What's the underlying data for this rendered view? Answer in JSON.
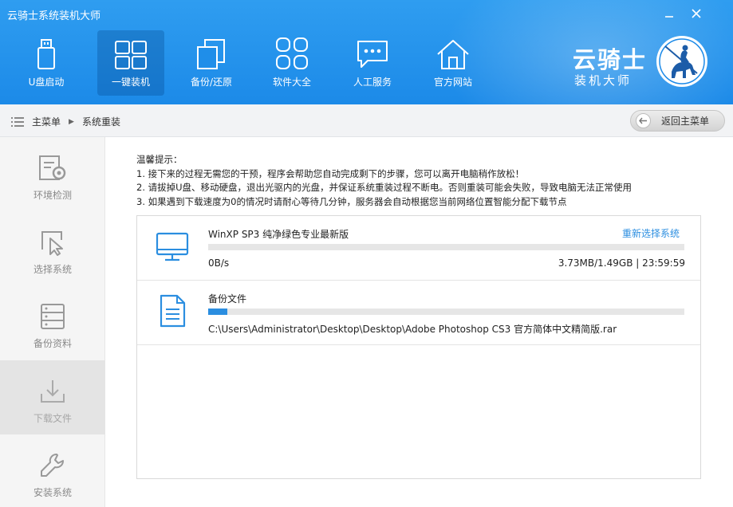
{
  "window": {
    "title": "云骑士系统装机大师",
    "minimize_icon": "minimize-icon",
    "close_icon": "close-icon"
  },
  "nav": [
    {
      "label": "U盘启动",
      "icon": "usb-drive-icon"
    },
    {
      "label": "一键装机",
      "icon": "windows-icon",
      "active": true
    },
    {
      "label": "备份/还原",
      "icon": "backup-restore-icon"
    },
    {
      "label": "软件大全",
      "icon": "apps-grid-icon"
    },
    {
      "label": "人工服务",
      "icon": "chat-bubble-icon"
    },
    {
      "label": "官方网站",
      "icon": "home-icon"
    }
  ],
  "brand": {
    "name": "云骑士",
    "subtitle": "装机大师",
    "logo_icon": "knight-rider-logo"
  },
  "breadcrumb": {
    "root": "主菜单",
    "current": "系统重装",
    "back_label": "返回主菜单"
  },
  "sidebar": [
    {
      "label": "环境检测",
      "icon": "env-check-icon"
    },
    {
      "label": "选择系统",
      "icon": "select-cursor-icon"
    },
    {
      "label": "备份资料",
      "icon": "database-icon"
    },
    {
      "label": "下载文件",
      "icon": "download-icon",
      "active": true
    },
    {
      "label": "安装系统",
      "icon": "wrench-icon"
    }
  ],
  "tips": {
    "heading": "温馨提示：",
    "lines": [
      "1. 接下来的过程无需您的干预，程序会帮助您自动完成剩下的步骤，您可以离开电脑稍作放松！",
      "2. 请拔掉U盘、移动硬盘，退出光驱内的光盘，并保证系统重装过程不断电。否则重装可能会失败，导致电脑无法正常使用",
      "3. 如果遇到下载速度为0的情况时请耐心等待几分钟，服务器会自动根据您当前网络位置智能分配下载节点"
    ]
  },
  "downloads": [
    {
      "name": "WinXP SP3 纯净绿色专业最新版",
      "link": "重新选择系统",
      "speed": "0B/s",
      "status": "3.73MB/1.49GB | 23:59:59",
      "progress": 0.0,
      "icon": "monitor-icon"
    },
    {
      "name": "备份文件",
      "path": "C:\\Users\\Administrator\\Desktop\\Desktop\\Adobe Photoshop CS3 官方简体中文精简版.rar",
      "progress": 0.04,
      "icon": "document-icon"
    }
  ],
  "colors": {
    "header_blue": "#1c8ae8",
    "accent_blue": "#2b8ee0",
    "sidebar_bg": "#f5f5f5"
  }
}
